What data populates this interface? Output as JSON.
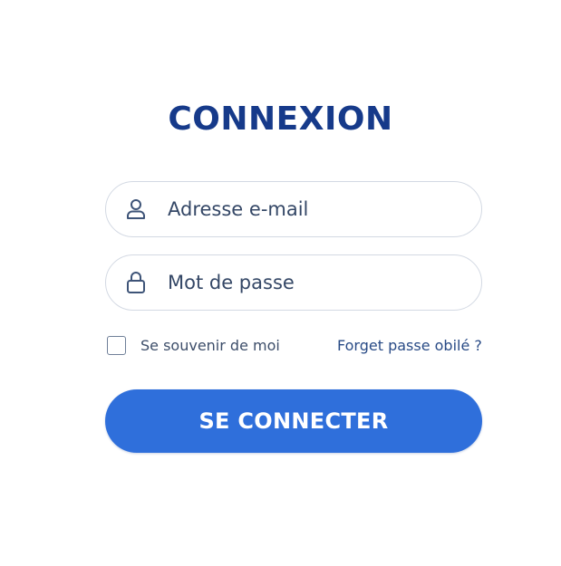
{
  "login": {
    "title": "CONNEXION",
    "email_field": {
      "placeholder": "Adresse e-mail",
      "value": "",
      "icon": "user-icon"
    },
    "password_field": {
      "placeholder": "Mot de passe",
      "value": "",
      "icon": "lock-icon"
    },
    "remember_me": {
      "label": "Se souvenir de moi",
      "checked": false
    },
    "forgot_link": "Forget passe obilé ?",
    "submit_label": "SE CONNECTER"
  },
  "colors": {
    "title": "#163a8a",
    "button": "#2f6fdb",
    "button_text": "#ffffff",
    "field_border": "#d3d9e3",
    "icon": "#3e5478",
    "link": "#294b86"
  }
}
